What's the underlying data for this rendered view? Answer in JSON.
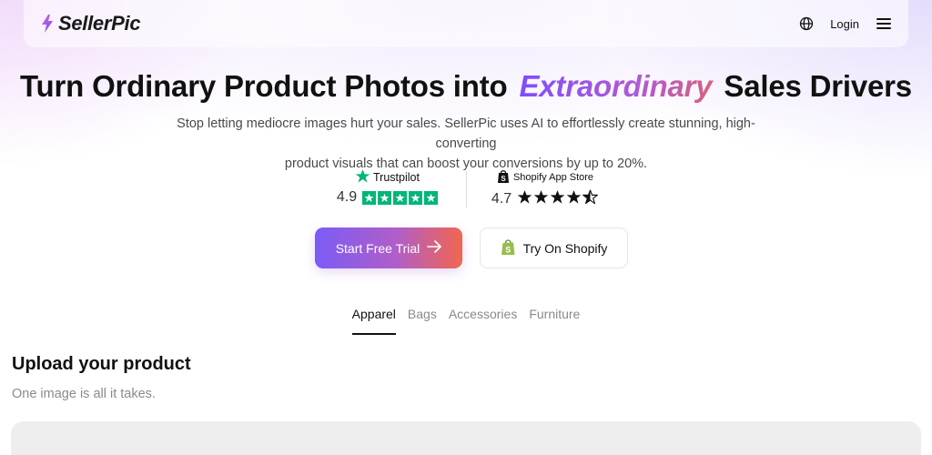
{
  "header": {
    "brand_name": "SellerPic",
    "login_label": "Login",
    "icons": [
      "brand-bolt-icon",
      "globe-icon",
      "hamburger-menu-icon"
    ]
  },
  "hero": {
    "title_before": "Turn Ordinary Product Photos into",
    "title_accent": "Extraordinary",
    "title_after": "Sales Drivers",
    "subtitle_line1": "Stop letting mediocre images hurt your sales. SellerPic uses AI to effortlessly create stunning, high-converting",
    "subtitle_line2": "product visuals that can boost your conversions by up to 20%."
  },
  "ratings": {
    "trustpilot": {
      "source": "Trustpilot",
      "score": "4.9",
      "stars": 5
    },
    "shopify": {
      "source": "Shopify App Store",
      "score": "4.7",
      "stars": 4.5
    }
  },
  "cta": {
    "primary_label": "Start Free Trial",
    "secondary_label": "Try On Shopify"
  },
  "tabs": [
    {
      "label": "Apparel",
      "active": true
    },
    {
      "label": "Bags",
      "active": false
    },
    {
      "label": "Accessories",
      "active": false
    },
    {
      "label": "Furniture",
      "active": false
    }
  ],
  "upload": {
    "title": "Upload your product",
    "subtitle": "One image is all it takes."
  },
  "colors": {
    "trustpilot_green": "#00b67a",
    "accent_gradient_start": "#7b5cf5",
    "accent_gradient_end": "#f2664d",
    "shopify_green": "#95bf47"
  }
}
